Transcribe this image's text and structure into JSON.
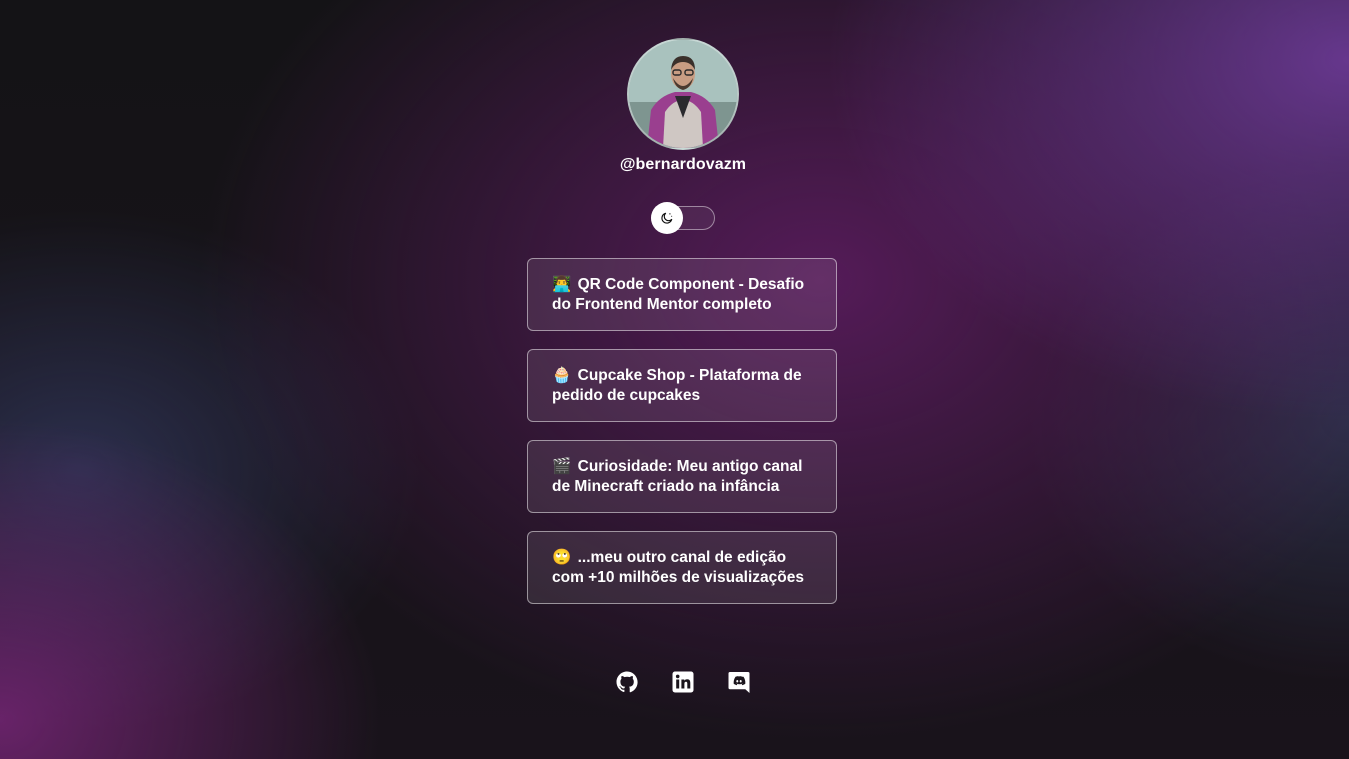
{
  "profile": {
    "handle": "@bernardovazm",
    "avatar_icon": "profile-photo"
  },
  "theme_toggle": {
    "icon": "moon-icon",
    "state": "dark"
  },
  "links": [
    {
      "emoji": "👨‍💻",
      "icon": "technologist-emoji",
      "label": "QR Code Component - Desafio do Frontend Mentor completo"
    },
    {
      "emoji": "🧁",
      "icon": "cupcake-emoji",
      "label": "Cupcake Shop - Plataforma de pedido de cupcakes"
    },
    {
      "emoji": "🎬",
      "icon": "clapper-board-emoji",
      "label": "Curiosidade: Meu antigo canal de Minecraft criado na infância"
    },
    {
      "emoji": "🙄",
      "icon": "face-with-rolling-eyes-emoji",
      "label": "...meu outro canal de edição com +10 milhões de visualizações"
    }
  ],
  "socials": [
    {
      "icon": "github-icon"
    },
    {
      "icon": "linkedin-icon"
    },
    {
      "icon": "discord-icon"
    }
  ],
  "colors": {
    "text": "#ffffff",
    "card_border": "rgba(255,255,255,0.5)",
    "accent_purple": "#7a40aa",
    "background": "#141215"
  }
}
